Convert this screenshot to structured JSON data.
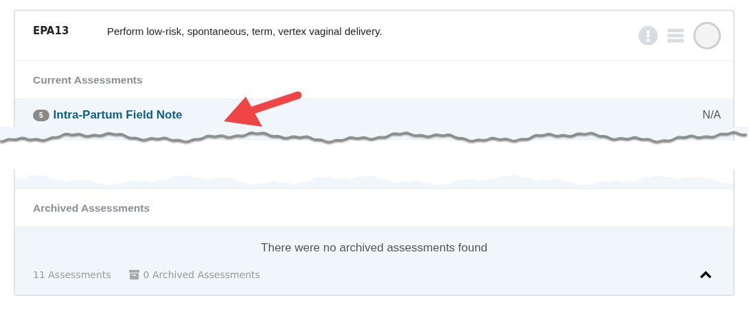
{
  "epa": {
    "code": "EPA13",
    "title": "Perform low-risk, spontaneous, term, vertex vaginal delivery."
  },
  "current_assessments": {
    "heading": "Current Assessments",
    "items": [
      {
        "count": "5",
        "name": "Intra-Partum Field Note",
        "value": "N/A"
      }
    ]
  },
  "archived_assessments": {
    "heading": "Archived Assessments",
    "empty_message": "There were no archived assessments found"
  },
  "footer": {
    "assessments": "11 Assessments",
    "archived": "0 Archived Assessments",
    "expanded": true
  }
}
